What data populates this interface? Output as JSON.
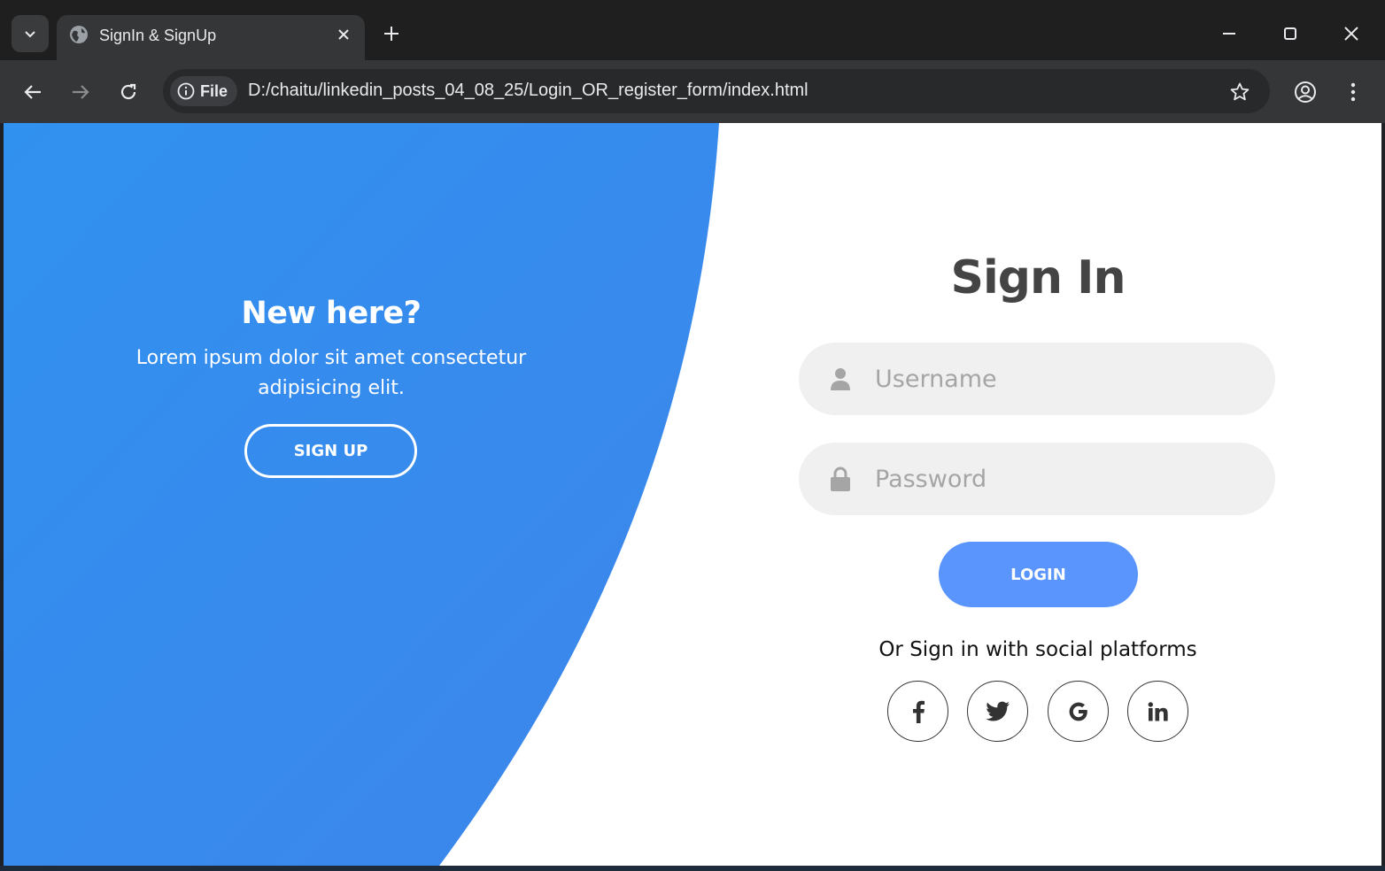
{
  "browser": {
    "tab_title": "SignIn & SignUp",
    "site_chip_label": "File",
    "url": "D:/chaitu/linkedin_posts_04_08_25/Login_OR_register_form/index.html"
  },
  "left_panel": {
    "title": "New here?",
    "text": "Lorem ipsum dolor sit amet consectetur adipisicing elit.",
    "button_label": "SIGN UP"
  },
  "form": {
    "title": "Sign In",
    "username_placeholder": "Username",
    "password_placeholder": "Password",
    "login_label": "LOGIN",
    "social_text": "Or Sign in with social platforms"
  },
  "social": [
    {
      "icon": "facebook-icon",
      "glyph": "f"
    },
    {
      "icon": "twitter-icon",
      "glyph": ""
    },
    {
      "icon": "google-icon",
      "glyph": "G"
    },
    {
      "icon": "linkedin-icon",
      "glyph": "in"
    }
  ],
  "colors": {
    "accent_blue": "#3a8ef0",
    "login_button": "#5995fd",
    "title_text": "#444444",
    "input_bg": "#f0f0f0"
  }
}
